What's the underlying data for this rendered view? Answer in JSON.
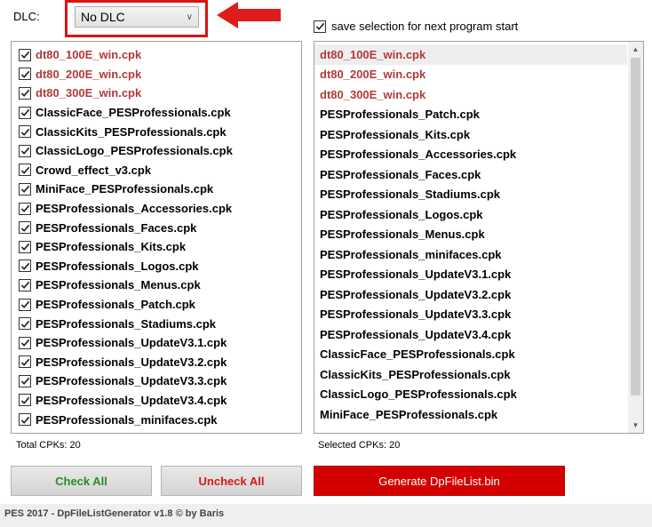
{
  "dlc": {
    "label": "DLC:",
    "selected": "No DLC"
  },
  "save_selection": {
    "checked": true,
    "label": "save selection for next program start"
  },
  "left_list": [
    {
      "label": "dt80_100E_win.cpk",
      "checked": true
    },
    {
      "label": "dt80_200E_win.cpk",
      "checked": true
    },
    {
      "label": "dt80_300E_win.cpk",
      "checked": true
    },
    {
      "label": "ClassicFace_PESProfessionals.cpk",
      "checked": true
    },
    {
      "label": "ClassicKits_PESProfessionals.cpk",
      "checked": true
    },
    {
      "label": "ClassicLogo_PESProfessionals.cpk",
      "checked": true
    },
    {
      "label": "Crowd_effect_v3.cpk",
      "checked": true
    },
    {
      "label": "MiniFace_PESProfessionals.cpk",
      "checked": true
    },
    {
      "label": "PESProfessionals_Accessories.cpk",
      "checked": true
    },
    {
      "label": "PESProfessionals_Faces.cpk",
      "checked": true
    },
    {
      "label": "PESProfessionals_Kits.cpk",
      "checked": true
    },
    {
      "label": "PESProfessionals_Logos.cpk",
      "checked": true
    },
    {
      "label": "PESProfessionals_Menus.cpk",
      "checked": true
    },
    {
      "label": "PESProfessionals_Patch.cpk",
      "checked": true
    },
    {
      "label": "PESProfessionals_Stadiums.cpk",
      "checked": true
    },
    {
      "label": "PESProfessionals_UpdateV3.1.cpk",
      "checked": true
    },
    {
      "label": "PESProfessionals_UpdateV3.2.cpk",
      "checked": true
    },
    {
      "label": "PESProfessionals_UpdateV3.3.cpk",
      "checked": true
    },
    {
      "label": "PESProfessionals_UpdateV3.4.cpk",
      "checked": true
    },
    {
      "label": "PESProfessionals_minifaces.cpk",
      "checked": true
    }
  ],
  "right_list": [
    "dt80_100E_win.cpk",
    "dt80_200E_win.cpk",
    "dt80_300E_win.cpk",
    "PESProfessionals_Patch.cpk",
    "PESProfessionals_Kits.cpk",
    "PESProfessionals_Accessories.cpk",
    "PESProfessionals_Faces.cpk",
    "PESProfessionals_Stadiums.cpk",
    "PESProfessionals_Logos.cpk",
    "PESProfessionals_Menus.cpk",
    "PESProfessionals_minifaces.cpk",
    "PESProfessionals_UpdateV3.1.cpk",
    "PESProfessionals_UpdateV3.2.cpk",
    "PESProfessionals_UpdateV3.3.cpk",
    "PESProfessionals_UpdateV3.4.cpk",
    "ClassicFace_PESProfessionals.cpk",
    "ClassicKits_PESProfessionals.cpk",
    "ClassicLogo_PESProfessionals.cpk",
    "MiniFace_PESProfessionals.cpk"
  ],
  "total_cpks": "Total CPKs: 20",
  "selected_cpks": "Selected CPKs: 20",
  "buttons": {
    "check_all": "Check All",
    "uncheck_all": "Uncheck All",
    "generate": "Generate DpFileList.bin"
  },
  "footer": "PES 2017 - DpFileListGenerator v1.8 © by Baris",
  "colors": {
    "highlight": "#d91414",
    "dt_text": "#b03a3a",
    "check_all_text": "#2a8a2a",
    "uncheck_all_text": "#d21a1a",
    "generate_bg": "#d40000"
  }
}
